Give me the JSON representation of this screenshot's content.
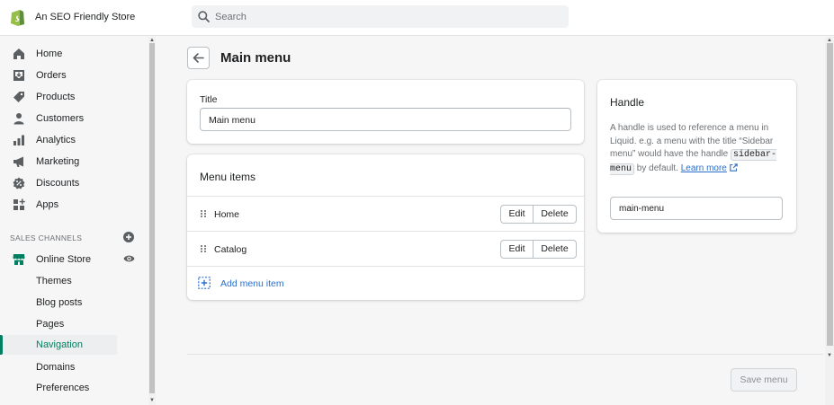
{
  "app": {
    "store_name": "An SEO Friendly Store",
    "brand_color": "#95bf47",
    "accent_color": "#008060",
    "link_color": "#2c6ecb"
  },
  "search": {
    "placeholder": "Search",
    "icon": "search-icon"
  },
  "sidebar": {
    "items": [
      {
        "label": "Home",
        "icon": "home-icon"
      },
      {
        "label": "Orders",
        "icon": "orders-icon"
      },
      {
        "label": "Products",
        "icon": "tag-icon"
      },
      {
        "label": "Customers",
        "icon": "person-icon"
      },
      {
        "label": "Analytics",
        "icon": "bar-chart-icon"
      },
      {
        "label": "Marketing",
        "icon": "megaphone-icon"
      },
      {
        "label": "Discounts",
        "icon": "discount-icon"
      },
      {
        "label": "Apps",
        "icon": "apps-icon"
      }
    ],
    "sales_channels_heading": "SALES CHANNELS",
    "online_store": {
      "label": "Online Store",
      "icon": "store-icon"
    },
    "sub_items": [
      {
        "label": "Themes",
        "active": false
      },
      {
        "label": "Blog posts",
        "active": false
      },
      {
        "label": "Pages",
        "active": false
      },
      {
        "label": "Navigation",
        "active": true
      },
      {
        "label": "Domains",
        "active": false
      },
      {
        "label": "Preferences",
        "active": false
      }
    ]
  },
  "page": {
    "title": "Main menu"
  },
  "title_card": {
    "label": "Title",
    "value": "Main menu"
  },
  "menu_items": {
    "heading": "Menu items",
    "rows": [
      {
        "label": "Home",
        "edit": "Edit",
        "delete": "Delete"
      },
      {
        "label": "Catalog",
        "edit": "Edit",
        "delete": "Delete"
      }
    ],
    "add_label": "Add menu item"
  },
  "handle_card": {
    "heading": "Handle",
    "desc_part1": "A handle is used to reference a menu in Liquid. e.g. a menu with the title “Sidebar menu” would have the handle ",
    "code": "sidebar-menu",
    "desc_part2": " by default. ",
    "learn_more": "Learn more",
    "value": "main-menu"
  },
  "footer": {
    "save_label": "Save menu"
  }
}
